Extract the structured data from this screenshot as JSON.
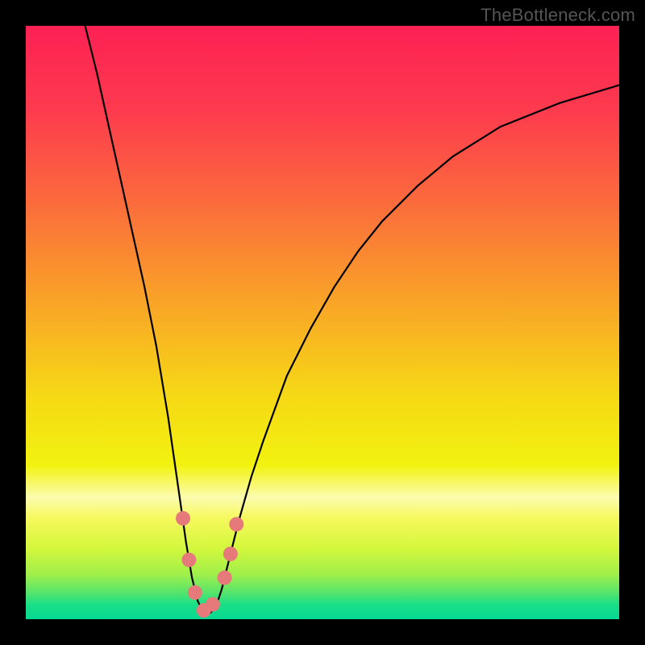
{
  "watermark": "TheBottleneck.com",
  "chart_data": {
    "type": "line",
    "title": "",
    "xlabel": "",
    "ylabel": "",
    "xlim": [
      0,
      100
    ],
    "ylim": [
      0,
      100
    ],
    "grid": false,
    "legend": false,
    "curve": {
      "name": "bottleneck-curve",
      "color": "#000000",
      "x": [
        10,
        12,
        14,
        16,
        18,
        20,
        22,
        24,
        25,
        26,
        27,
        28,
        29,
        30,
        31,
        32,
        33,
        34,
        36,
        38,
        40,
        44,
        48,
        52,
        56,
        60,
        66,
        72,
        80,
        90,
        100
      ],
      "y": [
        100,
        92,
        83,
        74,
        65,
        56,
        46,
        34,
        27,
        20,
        13,
        7,
        3,
        1,
        1,
        2,
        5,
        9,
        17,
        24,
        30,
        41,
        49,
        56,
        62,
        67,
        73,
        78,
        83,
        87,
        90
      ]
    },
    "markers": {
      "name": "highlight-points",
      "color": "#e67a7a",
      "points": [
        {
          "x": 26.5,
          "y": 17
        },
        {
          "x": 27.5,
          "y": 10
        },
        {
          "x": 28.5,
          "y": 4.5
        },
        {
          "x": 30,
          "y": 1.5
        },
        {
          "x": 31.5,
          "y": 2.5
        },
        {
          "x": 33.5,
          "y": 7
        },
        {
          "x": 34.5,
          "y": 11
        },
        {
          "x": 35.5,
          "y": 16
        }
      ]
    },
    "background_gradient_stops": [
      {
        "offset": 0,
        "color": "#fd2154"
      },
      {
        "offset": 0.14,
        "color": "#fd3a4e"
      },
      {
        "offset": 0.3,
        "color": "#fb6c3c"
      },
      {
        "offset": 0.46,
        "color": "#f9a228"
      },
      {
        "offset": 0.62,
        "color": "#f6d816"
      },
      {
        "offset": 0.74,
        "color": "#f2f20f"
      },
      {
        "offset": 0.795,
        "color": "#fcfcb0"
      },
      {
        "offset": 0.83,
        "color": "#f6f95c"
      },
      {
        "offset": 0.88,
        "color": "#d4f73d"
      },
      {
        "offset": 0.925,
        "color": "#9fef4a"
      },
      {
        "offset": 0.955,
        "color": "#57e46c"
      },
      {
        "offset": 0.975,
        "color": "#1adf87"
      },
      {
        "offset": 1,
        "color": "#06d992"
      }
    ]
  }
}
